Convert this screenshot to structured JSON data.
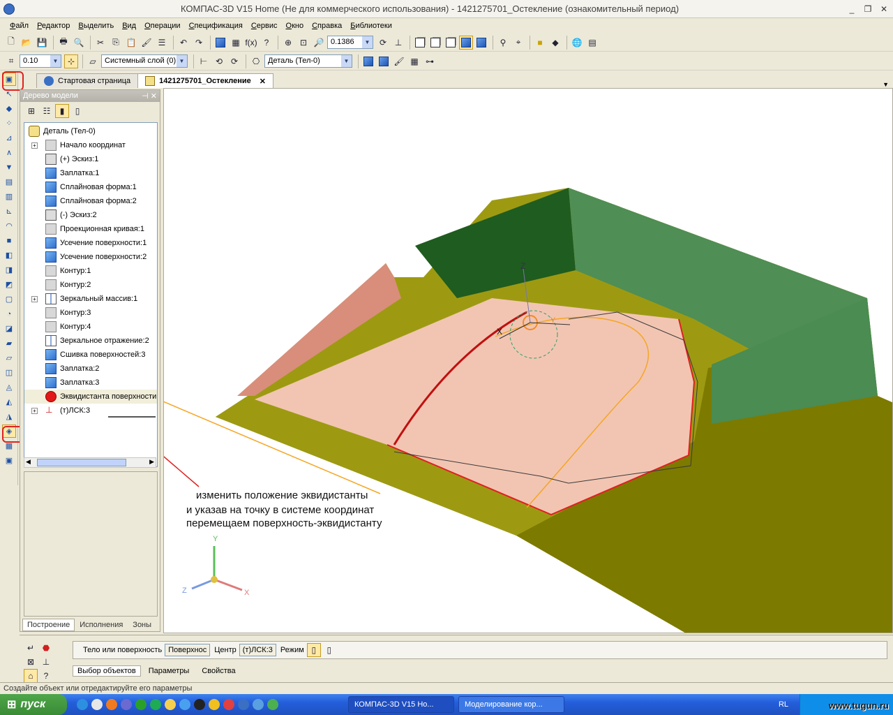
{
  "titlebar": {
    "title": "КОМПАС-3D V15 Home (Не для коммерческого использования) - 1421275701_Остекление (ознакомительный период)"
  },
  "menu": [
    "Файл",
    "Редактор",
    "Выделить",
    "Вид",
    "Операции",
    "Спецификация",
    "Сервис",
    "Окно",
    "Справка",
    "Библиотеки"
  ],
  "toolbar1": {
    "zoom_value": "0.1386",
    "fx_label": "f(x)"
  },
  "toolbar2": {
    "step_value": "0.10",
    "layer_value": "Системный слой (0)",
    "part_value": "Деталь (Тел-0)"
  },
  "doc_tabs": [
    {
      "label": "Стартовая страница"
    },
    {
      "label": "1421275701_Остекление"
    }
  ],
  "tree": {
    "header": "Дерево модели",
    "root": "Деталь (Тел-0)",
    "items": [
      {
        "label": "Начало координат"
      },
      {
        "label": "(+) Эскиз:1"
      },
      {
        "label": "Заплатка:1"
      },
      {
        "label": "Сплайновая форма:1"
      },
      {
        "label": "Сплайновая форма:2"
      },
      {
        "label": "(-) Эскиз:2"
      },
      {
        "label": "Проекционная кривая:1"
      },
      {
        "label": "Усечение поверхности:1"
      },
      {
        "label": "Усечение поверхности:2"
      },
      {
        "label": "Контур:1"
      },
      {
        "label": "Контур:2"
      },
      {
        "label": "Зеркальный массив:1"
      },
      {
        "label": "Контур:3"
      },
      {
        "label": "Контур:4"
      },
      {
        "label": "Зеркальное отражение:2"
      },
      {
        "label": "Сшивка поверхностей:3"
      },
      {
        "label": "Заплатка:2"
      },
      {
        "label": "Заплатка:3"
      },
      {
        "label": "Эквидистанта поверхности"
      },
      {
        "label": "(т)ЛСК:3"
      }
    ],
    "tabs": [
      "Построение",
      "Исполнения",
      "Зоны"
    ]
  },
  "annotation": {
    "line1": "изменить положение эквидистанты",
    "line2": "и указав на точку в системе координат",
    "line3": "перемещаем поверхность-эквидистанту"
  },
  "axes": {
    "x": "X",
    "y": "Y",
    "z": "Z"
  },
  "bottom_panel": {
    "label_body": "Тело или поверхность",
    "field_body": "Поверхнос",
    "label_center": "Центр",
    "field_center": "(т)ЛСК:3",
    "label_mode": "Режим",
    "tabs": [
      "Выбор объектов",
      "Параметры",
      "Свойства"
    ]
  },
  "status": "Создайте объект или отредактируйте его параметры",
  "taskbar": {
    "start": "пуск",
    "tasks": [
      "КОМПАС-3D V15 Ho...",
      "Моделирование кор..."
    ],
    "lang": "RL",
    "watermark": "www.tugun.ru"
  },
  "colors": {
    "accent": "#245edc",
    "highlight": "#ffe9a6",
    "red_marker": "#e02020",
    "orange_arrow": "#f5a623"
  }
}
